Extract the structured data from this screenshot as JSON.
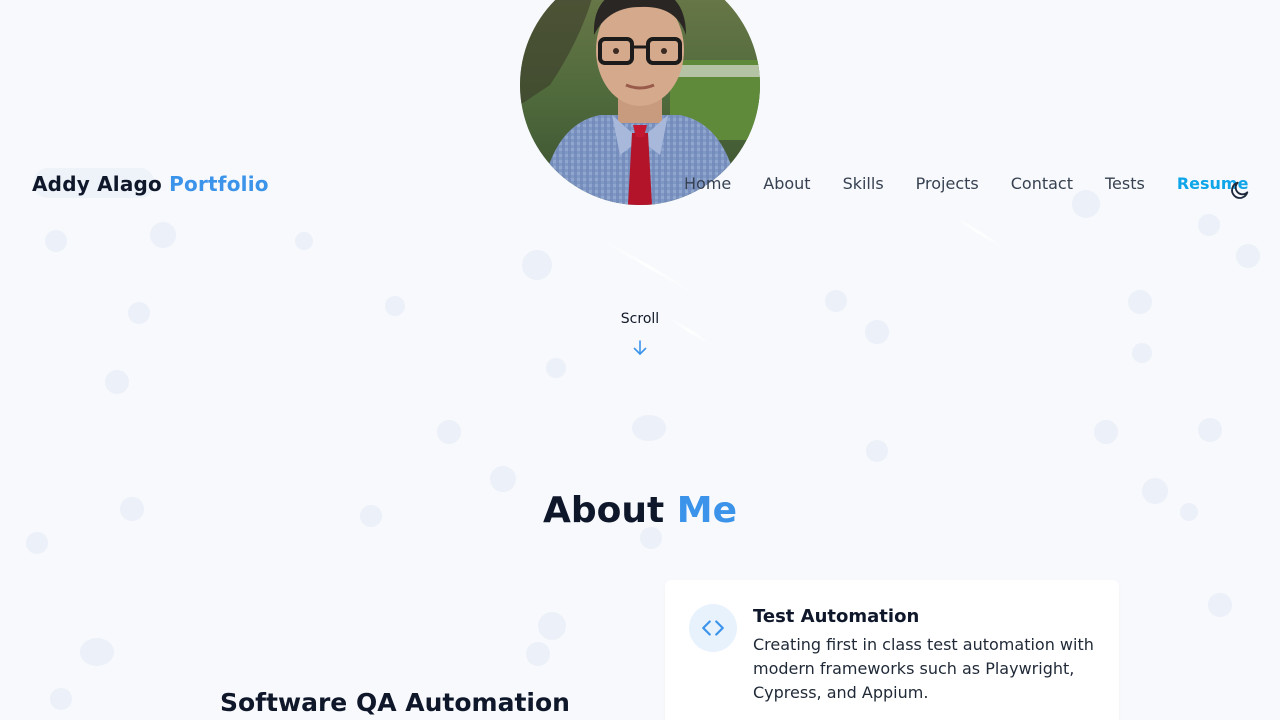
{
  "header": {
    "brand_first": "Addy Alago",
    "brand_accent": "Portfolio"
  },
  "nav": {
    "items": [
      "Home",
      "About",
      "Skills",
      "Projects",
      "Contact",
      "Tests"
    ],
    "resume": "Resume"
  },
  "hero": {
    "scroll_label": "Scroll"
  },
  "about": {
    "title_word1": "About",
    "title_word2": "Me",
    "role_heading": "Software QA Automation",
    "card": {
      "icon": "code-icon",
      "title": "Test Automation",
      "body": "Creating first in class test automation with modern frameworks such as Playwright, Cypress, and Appium."
    }
  },
  "colors": {
    "accent": "#3b94ea",
    "resume": "#0ea5e9",
    "background": "#f7f9fc",
    "heading": "#0f172a"
  }
}
